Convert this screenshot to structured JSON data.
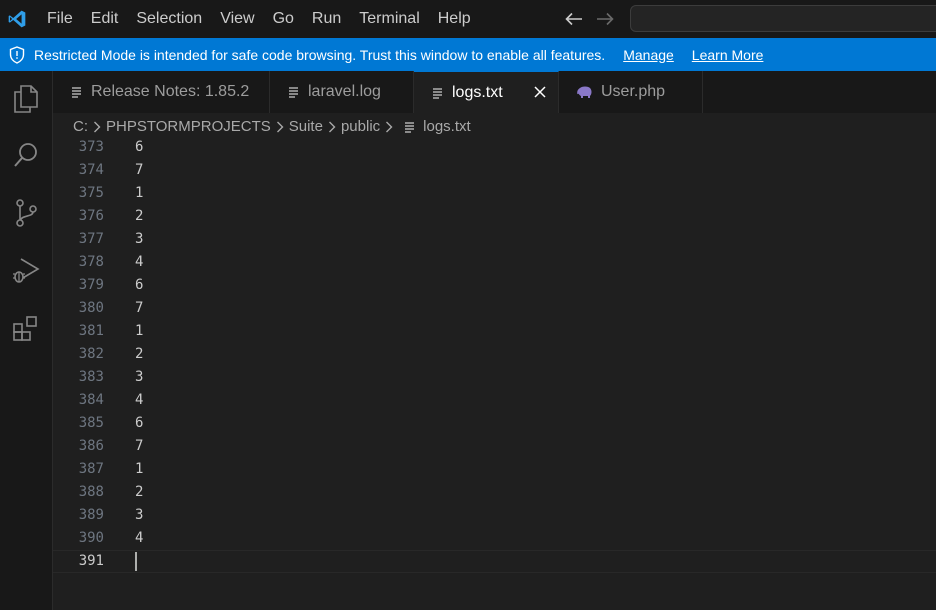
{
  "menu": [
    "File",
    "Edit",
    "Selection",
    "View",
    "Go",
    "Run",
    "Terminal",
    "Help"
  ],
  "banner": {
    "message": "Restricted Mode is intended for safe code browsing. Trust this window to enable all features.",
    "manage": "Manage",
    "learn_more": "Learn More"
  },
  "tabs": [
    {
      "label": "Release Notes: 1.85.2",
      "icon": "lines-icon"
    },
    {
      "label": "laravel.log",
      "icon": "lines-icon"
    },
    {
      "label": "logs.txt",
      "icon": "lines-icon",
      "active": true
    },
    {
      "label": "User.php",
      "icon": "php-elephant-icon"
    }
  ],
  "breadcrumb": [
    "C:",
    "PHPSTORMPROJECTS",
    "Suite",
    "public",
    "logs.txt"
  ],
  "editor": {
    "lines": [
      {
        "n": "373",
        "text": "6"
      },
      {
        "n": "374",
        "text": "7"
      },
      {
        "n": "375",
        "text": "1"
      },
      {
        "n": "376",
        "text": "2"
      },
      {
        "n": "377",
        "text": "3"
      },
      {
        "n": "378",
        "text": "4"
      },
      {
        "n": "379",
        "text": "6"
      },
      {
        "n": "380",
        "text": "7"
      },
      {
        "n": "381",
        "text": "1"
      },
      {
        "n": "382",
        "text": "2"
      },
      {
        "n": "383",
        "text": "3"
      },
      {
        "n": "384",
        "text": "4"
      },
      {
        "n": "385",
        "text": "6"
      },
      {
        "n": "386",
        "text": "7"
      },
      {
        "n": "387",
        "text": "1"
      },
      {
        "n": "388",
        "text": "2"
      },
      {
        "n": "389",
        "text": "3"
      },
      {
        "n": "390",
        "text": "4"
      },
      {
        "n": "391",
        "text": ""
      }
    ],
    "current_line": "391"
  },
  "colors": {
    "accent": "#0078d4",
    "php_icon": "#8a78c8"
  }
}
